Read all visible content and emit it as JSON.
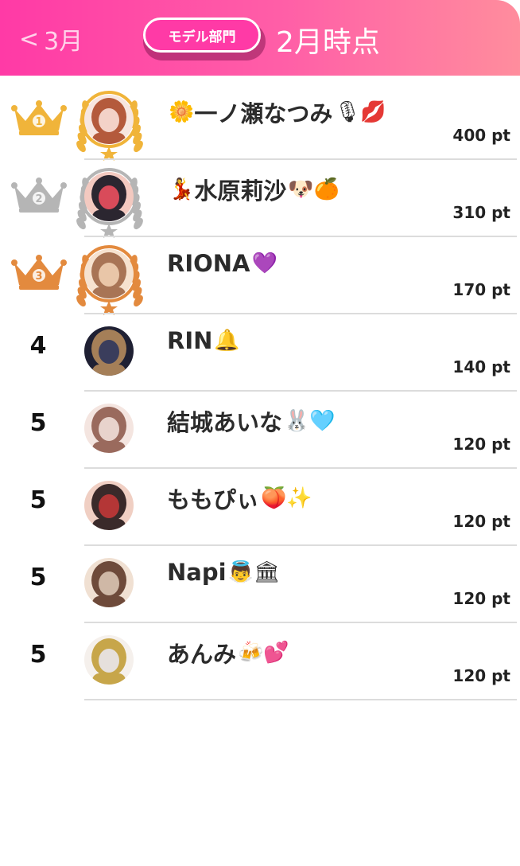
{
  "header": {
    "back_label": "3月",
    "back_chevron": "<",
    "category_pill": "モデル部門",
    "period_title": "2月時点",
    "gradient_start": "#ff3aa6",
    "gradient_end": "#ff8d9d"
  },
  "ranking": [
    {
      "rank": "1",
      "name": "一ノ瀬なつみ",
      "pre_emoji": "🌼",
      "post_emoji": "🎙💋",
      "points": "400 pt",
      "medal": "gold"
    },
    {
      "rank": "2",
      "name": "水原莉沙",
      "pre_emoji": "💃",
      "post_emoji": "🐶🍊",
      "points": "310 pt",
      "medal": "silver"
    },
    {
      "rank": "3",
      "name": "RIONA",
      "pre_emoji": "",
      "post_emoji": "💜",
      "points": "170 pt",
      "medal": "bronze"
    },
    {
      "rank": "4",
      "name": "RIN",
      "pre_emoji": "",
      "post_emoji": "🔔",
      "points": "140 pt",
      "medal": ""
    },
    {
      "rank": "5",
      "name": "結城あいな",
      "pre_emoji": "",
      "post_emoji": "🐰🩵",
      "points": "120 pt",
      "medal": ""
    },
    {
      "rank": "5",
      "name": "ももぴぃ",
      "pre_emoji": "",
      "post_emoji": "🍑✨",
      "points": "120 pt",
      "medal": ""
    },
    {
      "rank": "5",
      "name": "Napi",
      "pre_emoji": "",
      "post_emoji": "👼🏛",
      "points": "120 pt",
      "medal": ""
    },
    {
      "rank": "5",
      "name": "あんみ",
      "pre_emoji": "",
      "post_emoji": "🍻💕",
      "points": "120 pt",
      "medal": ""
    }
  ],
  "colors": {
    "gold": "#f0b43a",
    "silver": "#b5b5b5",
    "bronze": "#e38a3e",
    "divider": "#dcdcdc"
  }
}
